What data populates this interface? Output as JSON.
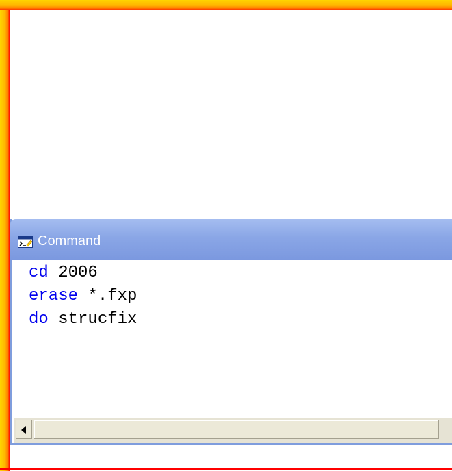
{
  "command_window": {
    "title": "Command",
    "icon": "command-window-icon",
    "lines": [
      {
        "keyword": "cd",
        "argument": " 2006"
      },
      {
        "keyword": "erase",
        "argument": " *.fxp"
      },
      {
        "keyword": "do",
        "argument": " strucfix"
      }
    ]
  },
  "colors": {
    "highlight_frame": "#ff0000",
    "highlight_glow": "#ffd400",
    "titlebar": "#8aa6e6",
    "keyword": "#0000ee"
  }
}
